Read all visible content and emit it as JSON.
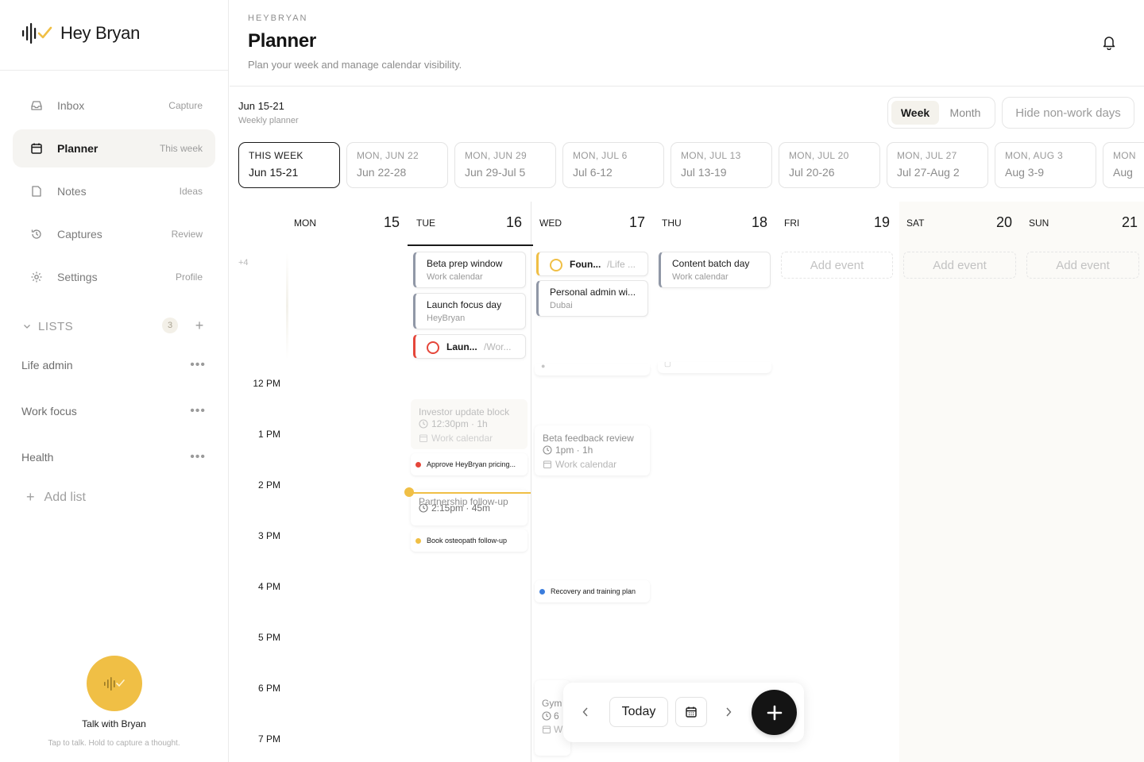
{
  "brand": {
    "name": "Hey Bryan"
  },
  "nav": [
    {
      "label": "Inbox",
      "hint": "Capture",
      "icon": "inbox-icon",
      "active": false
    },
    {
      "label": "Planner",
      "hint": "This week",
      "icon": "calendar-icon",
      "active": true
    },
    {
      "label": "Notes",
      "hint": "Ideas",
      "icon": "note-icon",
      "active": false
    },
    {
      "label": "Captures",
      "hint": "Review",
      "icon": "history-icon",
      "active": false
    },
    {
      "label": "Settings",
      "hint": "Profile",
      "icon": "gear-icon",
      "active": false
    }
  ],
  "lists": {
    "title": "LISTS",
    "count": "3",
    "items": [
      "Life admin",
      "Work focus",
      "Health"
    ],
    "add_label": "Add list"
  },
  "talk": {
    "title": "Talk with Bryan",
    "subtitle": "Tap to talk. Hold to capture a thought."
  },
  "header": {
    "eyebrow": "HEYBRYAN",
    "title": "Planner",
    "subtitle": "Plan your week and manage calendar visibility."
  },
  "range": {
    "label": "Jun 15-21",
    "sub": "Weekly planner"
  },
  "view_toggle": {
    "week": "Week",
    "month": "Month",
    "active": "Week"
  },
  "hide_nonwork": "Hide non-work days",
  "weeks": [
    {
      "top": "THIS WEEK",
      "bottom": "Jun 15-21",
      "selected": true
    },
    {
      "top": "MON, JUN 22",
      "bottom": "Jun 22-28"
    },
    {
      "top": "MON, JUN 29",
      "bottom": "Jun 29-Jul 5"
    },
    {
      "top": "MON, JUL 6",
      "bottom": "Jul 6-12"
    },
    {
      "top": "MON, JUL 13",
      "bottom": "Jul 13-19"
    },
    {
      "top": "MON, JUL 20",
      "bottom": "Jul 20-26"
    },
    {
      "top": "MON, JUL 27",
      "bottom": "Jul 27-Aug 2"
    },
    {
      "top": "MON, AUG 3",
      "bottom": "Aug 3-9"
    },
    {
      "top": "MON",
      "bottom": "Aug"
    }
  ],
  "days": [
    {
      "name": "MON",
      "num": "15"
    },
    {
      "name": "TUE",
      "num": "16",
      "today": true
    },
    {
      "name": "WED",
      "num": "17"
    },
    {
      "name": "THU",
      "num": "18"
    },
    {
      "name": "FRI",
      "num": "19"
    },
    {
      "name": "SAT",
      "num": "20"
    },
    {
      "name": "SUN",
      "num": "21"
    }
  ],
  "overflow": "+4",
  "hours": [
    "12 PM",
    "1 PM",
    "2 PM",
    "3 PM",
    "4 PM",
    "5 PM",
    "6 PM",
    "7 PM"
  ],
  "allday": {
    "tue": [
      {
        "title": "Beta prep window",
        "sub": "Work calendar"
      },
      {
        "title": "Launch focus day",
        "sub": "HeyBryan"
      },
      {
        "title": "Laun...",
        "sub": "/Wor..."
      }
    ],
    "wed": [
      {
        "title": "Foun...",
        "sub": "/Life ..."
      },
      {
        "title": "Personal admin wi...",
        "sub": "Dubai"
      }
    ],
    "thu": [
      {
        "title": "Content batch day",
        "sub": "Work calendar"
      }
    ],
    "add_event": "Add event"
  },
  "timed": {
    "investor": {
      "title": "Investor update block",
      "time": "12:30pm · 1h",
      "cal": "Work calendar"
    },
    "beta": {
      "title": "Beta feedback review",
      "time": "1pm · 1h",
      "cal": "Work calendar"
    },
    "partnership": {
      "title": "Partnership follow-up",
      "time": "2:15pm · 45m"
    },
    "gym": {
      "title": "Gym",
      "time": "6",
      "cal": "W"
    }
  },
  "tasks": {
    "approve": {
      "text": "Approve HeyBryan pricing...",
      "color": "#e5463a"
    },
    "osteo": {
      "text": "Book osteopath follow-up",
      "color": "#f0bf45"
    },
    "recovery": {
      "text": "Recovery and training plan",
      "color": "#3b7ddd"
    }
  },
  "toolbar": {
    "today": "Today"
  }
}
